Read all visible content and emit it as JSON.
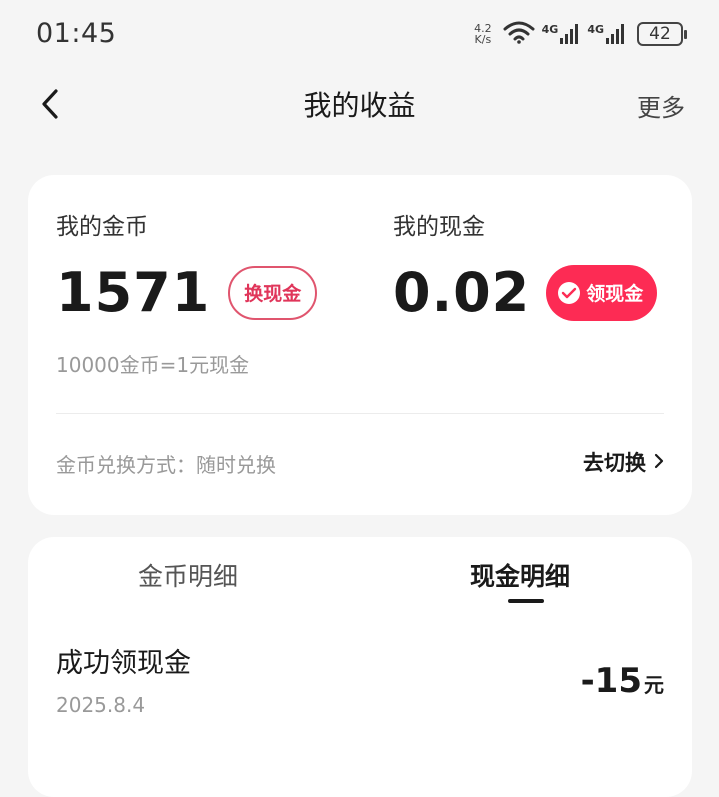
{
  "status_bar": {
    "time": "01:45",
    "net_speed_value": "4.2",
    "net_speed_unit": "K/s",
    "signal_1_label": "4G",
    "signal_2_label": "4G",
    "battery": "42"
  },
  "nav": {
    "title": "我的收益",
    "more": "更多"
  },
  "summary": {
    "coins_label": "我的金币",
    "coins_value": "1571",
    "exchange_button": "换现金",
    "cash_label": "我的现金",
    "cash_value": "0.02",
    "claim_button": "领现金",
    "rate_text": "10000金币=1元现金",
    "exchange_mode": "金币兑换方式：随时兑换",
    "switch_link": "去切换"
  },
  "details": {
    "tabs": [
      {
        "label": "金币明细",
        "active": false
      },
      {
        "label": "现金明细",
        "active": true
      }
    ],
    "records": [
      {
        "title": "成功领现金",
        "date": "2025.8.4",
        "amount": "-15",
        "unit": "元"
      }
    ]
  },
  "colors": {
    "accent": "#fd2b54",
    "outline_accent": "#e0556e",
    "background": "#f5f5f5"
  }
}
